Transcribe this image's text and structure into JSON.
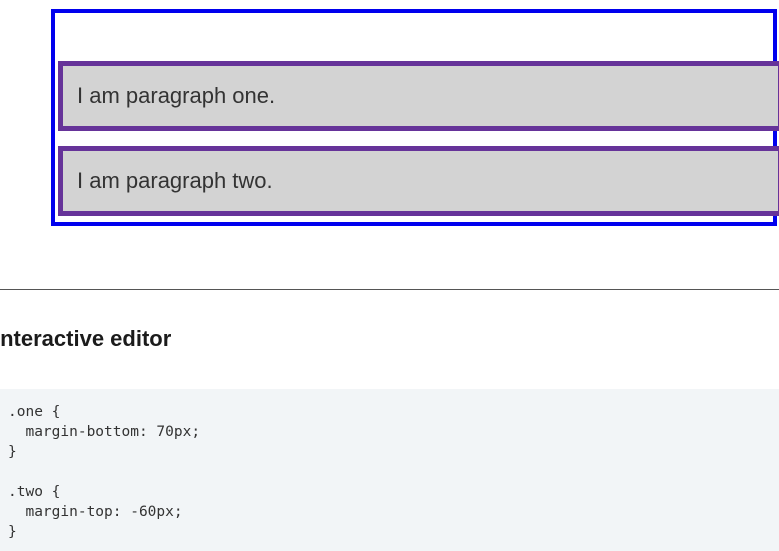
{
  "demo": {
    "paragraph_one": "I am paragraph one.",
    "paragraph_two": "I am paragraph two."
  },
  "editor": {
    "heading": "Interactive editor",
    "code_lines": [
      ".one {",
      "  margin-bottom: 70px;",
      "}",
      "",
      ".two {",
      "  margin-top: -60px;",
      "}"
    ]
  },
  "colors": {
    "container_border": "#0000ee",
    "paragraph_border": "#663399",
    "paragraph_background": "#d3d3d3",
    "editor_background": "#f2f5f7"
  }
}
